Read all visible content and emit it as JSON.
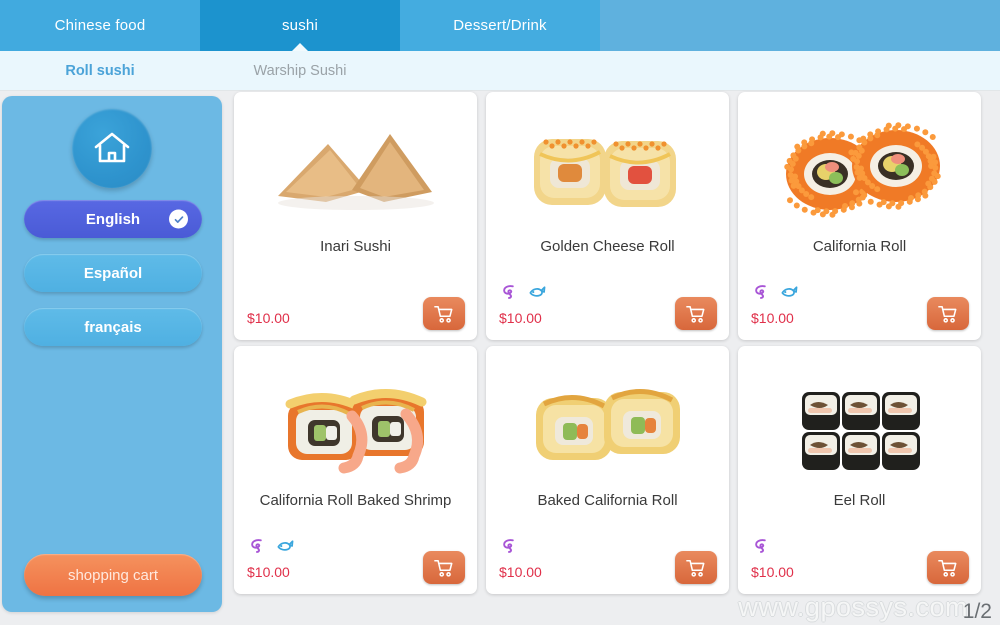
{
  "tabs": [
    {
      "label": "Chinese food",
      "active": false
    },
    {
      "label": "sushi",
      "active": true
    },
    {
      "label": "Dessert/Drink",
      "active": false
    }
  ],
  "subtabs": [
    {
      "label": "Roll sushi",
      "active": true
    },
    {
      "label": "Warship Sushi",
      "active": false
    }
  ],
  "sidebar": {
    "home_icon": "home-icon",
    "languages": [
      {
        "label": "English",
        "selected": true
      },
      {
        "label": "Español",
        "selected": false
      },
      {
        "label": "français",
        "selected": false
      }
    ],
    "cart_label": "shopping cart"
  },
  "products": [
    {
      "name": "Inari Sushi",
      "price": "$10.00",
      "tags": [],
      "image": "inari-sushi-photo"
    },
    {
      "name": "Golden Cheese Roll",
      "price": "$10.00",
      "tags": [
        "shrimp",
        "fish"
      ],
      "image": "golden-cheese-roll-photo"
    },
    {
      "name": "California Roll",
      "price": "$10.00",
      "tags": [
        "shrimp",
        "fish"
      ],
      "image": "california-roll-photo"
    },
    {
      "name": "California Roll Baked Shrimp",
      "price": "$10.00",
      "tags": [
        "shrimp",
        "fish"
      ],
      "image": "california-roll-baked-shrimp-photo"
    },
    {
      "name": "Baked California Roll",
      "price": "$10.00",
      "tags": [
        "shrimp"
      ],
      "image": "baked-california-roll-photo"
    },
    {
      "name": "Eel Roll",
      "price": "$10.00",
      "tags": [
        "shrimp"
      ],
      "image": "eel-roll-photo"
    }
  ],
  "footer": {
    "watermark": "www.gpossys.com",
    "page": "1/2"
  },
  "colors": {
    "tab_active": "#1c93ce",
    "tab_inactive": "#41aadf",
    "sidebar": "#6cb9e4",
    "language_selected": "#4a5bd6",
    "cart_orange": "#ef7343",
    "price_red": "#e0304a",
    "tag_shrimp": "#a855d6",
    "tag_fish": "#3aa6dd"
  }
}
